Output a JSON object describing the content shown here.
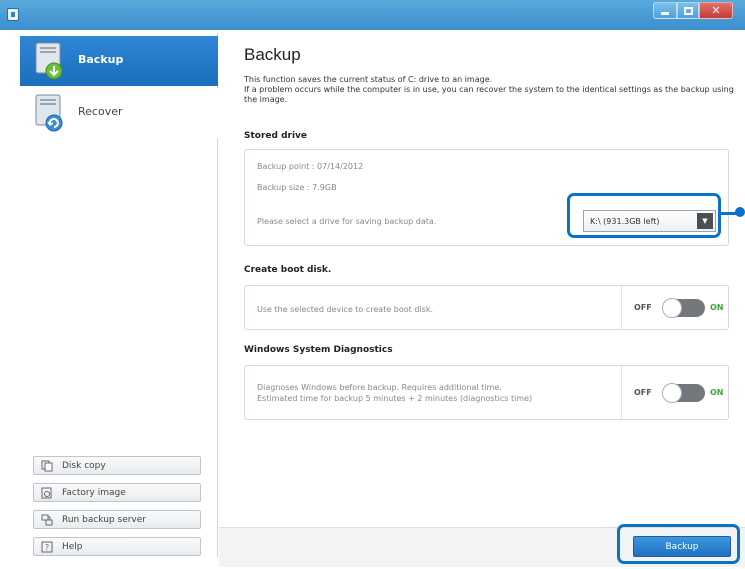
{
  "window": {
    "title": ""
  },
  "sidebar": {
    "nav": [
      {
        "label": "Backup",
        "icon": "backup-drive-icon",
        "active": true
      },
      {
        "label": "Recover",
        "icon": "recover-drive-icon",
        "active": false
      }
    ],
    "buttons": [
      {
        "label": "Disk copy",
        "icon": "disk-copy-icon"
      },
      {
        "label": "Factory image",
        "icon": "factory-image-icon"
      },
      {
        "label": "Run backup server",
        "icon": "backup-server-icon"
      },
      {
        "label": "Help",
        "icon": "help-icon"
      }
    ]
  },
  "main": {
    "title": "Backup",
    "description": [
      "This function saves the current status of C: drive to an image.",
      "If a problem occurs while the computer is in use, you can recover the system to the identical settings as the backup using the image."
    ],
    "stored_drive": {
      "heading": "Stored drive",
      "backup_point": "Backup point : 07/14/2012",
      "backup_size": "Backup size : 7.9GB",
      "select_prompt": "Please select a drive for saving backup data.",
      "selected_drive": "K:\\ (931.3GB left)"
    },
    "boot_disk": {
      "heading": "Create boot disk.",
      "text": "Use the selected device to create boot disk.",
      "off_label": "OFF",
      "on_label": "ON",
      "state": "off"
    },
    "diagnostics": {
      "heading": "Windows System Diagnostics",
      "line1": "Diagnoses Windows before backup. Requires additional time.",
      "line2": "Estimated time for backup 5 minutes + 2 minutes (diagnostics time)",
      "off_label": "OFF",
      "on_label": "ON",
      "state": "off"
    },
    "backup_button": "Backup"
  },
  "colors": {
    "accent": "#1f72c4",
    "titlebar": "#3a8fcf",
    "callout": "#0b73c6",
    "on_green": "#3aa83a"
  }
}
